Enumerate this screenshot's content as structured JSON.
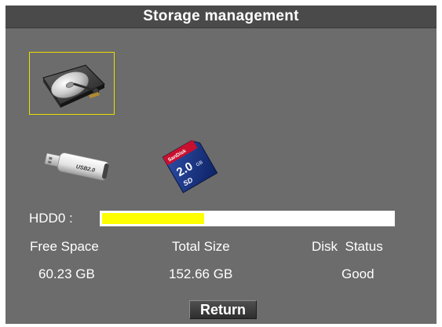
{
  "window": {
    "title": "Storage management"
  },
  "devices": [
    {
      "name": "hard-disk",
      "icon": "hard-disk-icon",
      "selected": true
    },
    {
      "name": "usb-drive",
      "icon": "usb-drive-icon",
      "selected": false
    },
    {
      "name": "sd-card",
      "icon": "sd-card-icon",
      "selected": false
    }
  ],
  "sd_card": {
    "brand": "SanDisk",
    "capacity": "2.0",
    "unit": "GB",
    "type": "SD"
  },
  "usb_drive": {
    "label": "USB2.0"
  },
  "hdd": {
    "label": "HDD0 :",
    "used_fraction": 0.35
  },
  "info": {
    "free_space_label": "Free Space",
    "total_size_label": "Total Size",
    "disk_status_label": "Disk  Status",
    "free_space_value": "60.23 GB",
    "total_size_value": "152.66 GB",
    "disk_status_value": "Good"
  },
  "buttons": {
    "return_label": "Return"
  },
  "colors": {
    "background": "#6c6c6c",
    "title_bar": "#4a4a4a",
    "selection_border": "#e8e000",
    "usage_fill": "#ffff00",
    "usage_track": "#ffffff"
  }
}
